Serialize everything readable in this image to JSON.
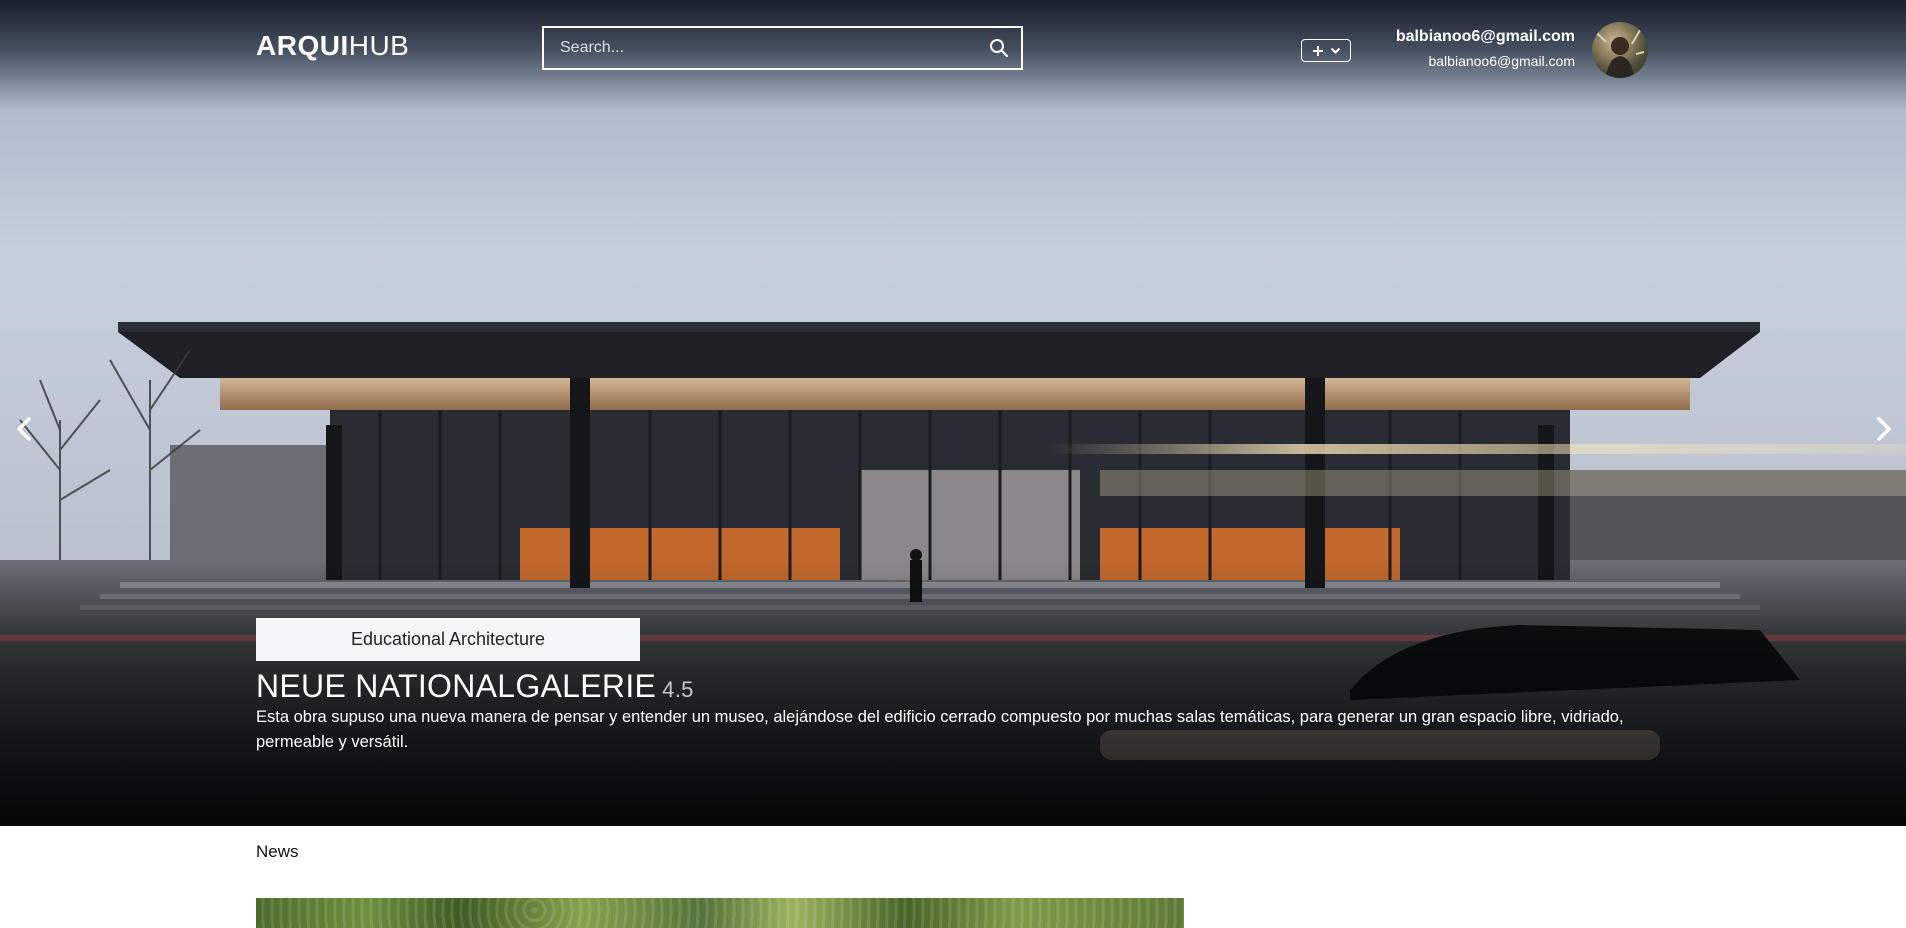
{
  "header": {
    "logo_bold": "ARQUI",
    "logo_light": "HUB",
    "search_placeholder": "Search...",
    "add_button_label": "+",
    "user_name": "balbianoo6@gmail.com",
    "user_email": "balbianoo6@gmail.com"
  },
  "hero": {
    "category": "Educational Architecture",
    "title": "NEUE NATIONALGALERIE",
    "rating": "4.5",
    "description": "Esta obra supuso una nueva manera de pensar y entender un museo, alejándose del edificio cerrado compuesto por muchas salas temáticas, para generar un gran espacio libre, vidriado, permeable y versátil."
  },
  "section": {
    "news_label": "News"
  },
  "icons": {
    "search": "search-icon",
    "add": "plus-icon",
    "dropdown": "chevron-down-icon",
    "prev": "chevron-left-icon",
    "next": "chevron-right-icon"
  },
  "colors": {
    "header_bg": "#1b2231",
    "tag_bg": "#f4f5f7",
    "text_light": "#ffffff",
    "orange_glow": "#c7672a"
  }
}
